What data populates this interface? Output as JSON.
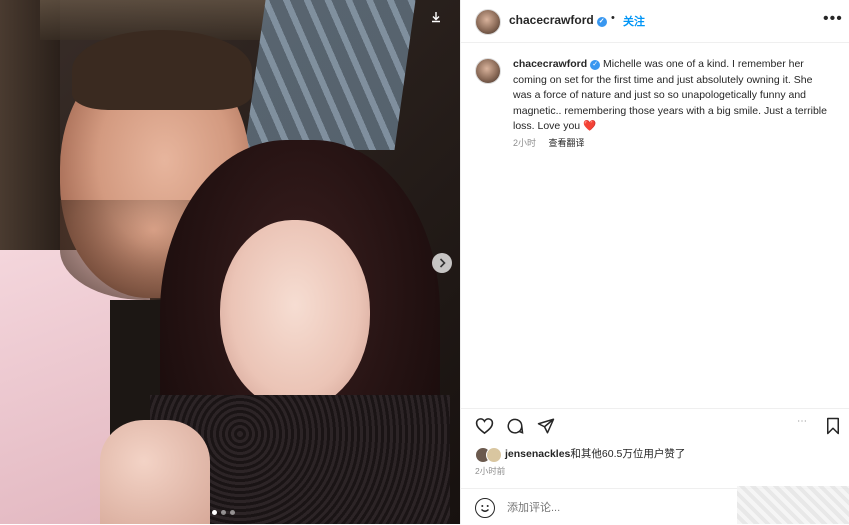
{
  "post": {
    "photo": {
      "download_icon": "download-icon",
      "next_icon": "chevron-right-icon",
      "carousel_total": 3,
      "carousel_active": 1
    },
    "header": {
      "username": "chacecrawford",
      "verified_glyph": "✓",
      "separator": "•",
      "follow_label": "关注",
      "more_glyph": "•••"
    },
    "caption": {
      "username": "chacecrawford",
      "text": "Michelle was one of a kind. I remember her coming on set for the first time and just absolutely owning it. She was a force of nature and just so so unapologetically funny and magnetic.. remembering those years with a big smile. Just a terrible loss. Love you",
      "heart": "❤️",
      "time": "2小时",
      "translate": "查看翻译"
    },
    "actions": {
      "like_icon": "heart-icon",
      "comment_icon": "comment-icon",
      "share_icon": "send-icon",
      "save_icon": "bookmark-icon",
      "more_glyph": "⋯"
    },
    "likes": {
      "user": "jensenackles",
      "rest": "和其他60.5万位用户赞了"
    },
    "timestamp": "2小时前",
    "comment": {
      "placeholder": "添加评论...",
      "emoji_icon": "smiley-icon"
    }
  },
  "colors": {
    "accent": "#0095f6",
    "verified": "#3897f0",
    "heart": "#ed4956",
    "text": "#262626",
    "muted": "#8e8e8e"
  }
}
